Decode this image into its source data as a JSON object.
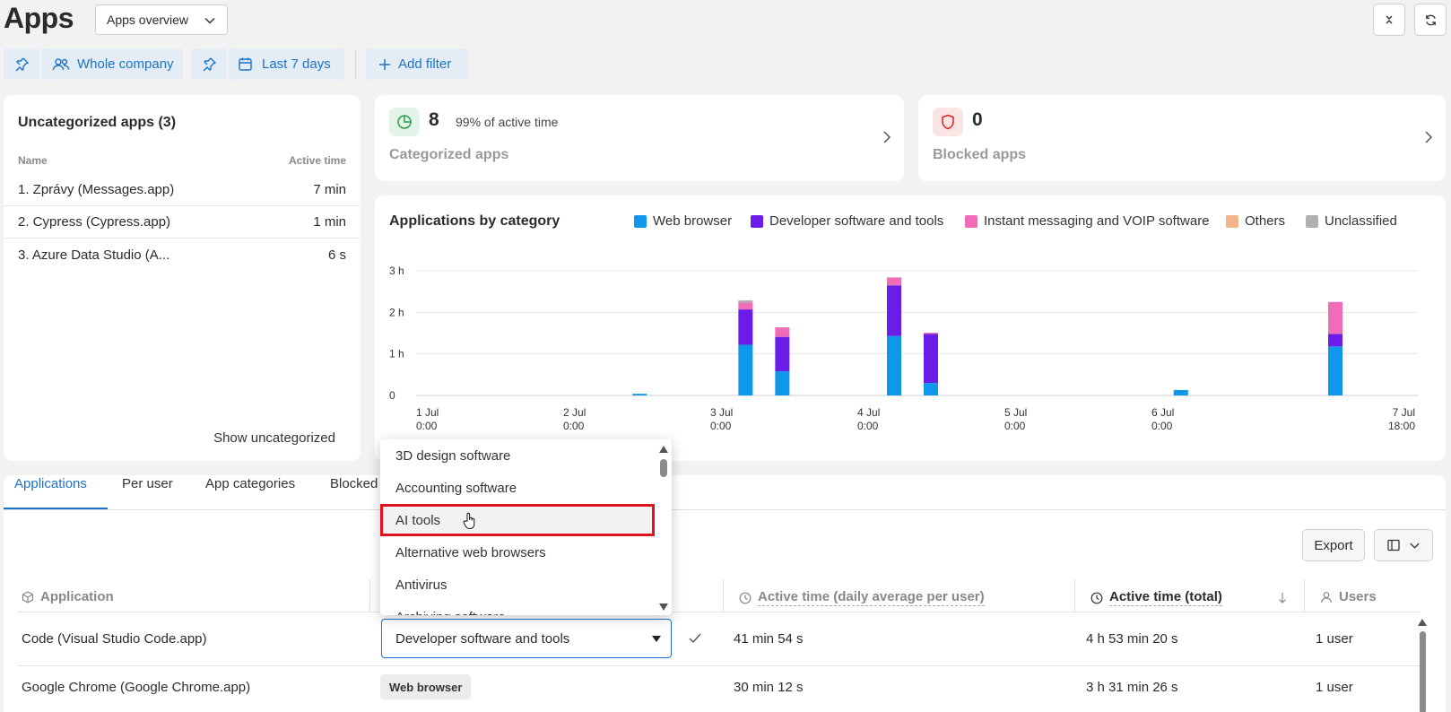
{
  "header": {
    "title": "Apps",
    "view_select": "Apps overview"
  },
  "filters": {
    "scope": "Whole company",
    "period": "Last 7 days",
    "add_filter": "Add filter"
  },
  "uncategorized": {
    "title": "Uncategorized apps (3)",
    "col_name": "Name",
    "col_time": "Active time",
    "rows": [
      {
        "name": "1. Zprávy (Messages.app)",
        "time": "7 min"
      },
      {
        "name": "2. Cypress (Cypress.app)",
        "time": "1 min"
      },
      {
        "name": "3. Azure Data Studio (A...",
        "time": "6 s"
      }
    ],
    "show_link": "Show uncategorized"
  },
  "categorized": {
    "count": "8",
    "sub": "99% of active time",
    "label": "Categorized apps"
  },
  "blocked": {
    "count": "0",
    "label": "Blocked apps"
  },
  "colors": {
    "web_browser": "#0f97ec",
    "developer": "#6a1de8",
    "messaging": "#f06cb8",
    "others": "#f4b48a",
    "unclassified": "#b0b0b0",
    "accent": "#1a73c9"
  },
  "chart_data": {
    "type": "bar",
    "title": "Applications by category",
    "stacked": true,
    "y_unit": "hours",
    "y_ticks": [
      "0",
      "1 h",
      "2 h",
      "3 h"
    ],
    "ylim": [
      0,
      3
    ],
    "x_ticks": [
      {
        "line1": "1 Jul",
        "line2": "0:00"
      },
      {
        "line1": "2 Jul",
        "line2": "0:00"
      },
      {
        "line1": "3 Jul",
        "line2": "0:00"
      },
      {
        "line1": "4 Jul",
        "line2": "0:00"
      },
      {
        "line1": "5 Jul",
        "line2": "0:00"
      },
      {
        "line1": "6 Jul",
        "line2": "0:00"
      },
      {
        "line1": "7 Jul",
        "line2": "18:00"
      }
    ],
    "legend": [
      {
        "name": "Web browser",
        "color_key": "web_browser"
      },
      {
        "name": "Developer software and tools",
        "color_key": "developer"
      },
      {
        "name": "Instant messaging and VOIP software",
        "color_key": "messaging"
      },
      {
        "name": "Others",
        "color_key": "others"
      },
      {
        "name": "Unclassified",
        "color_key": "unclassified"
      }
    ],
    "bars": [
      {
        "day_offset": 1.52,
        "web": 0.04,
        "dev": 0,
        "msg": 0,
        "other": 0,
        "uncl": 0
      },
      {
        "day_offset": 2.24,
        "web": 1.22,
        "dev": 0.85,
        "msg": 0.17,
        "other": 0,
        "uncl": 0.05
      },
      {
        "day_offset": 2.49,
        "web": 0.58,
        "dev": 0.83,
        "msg": 0.23,
        "other": 0,
        "uncl": 0
      },
      {
        "day_offset": 3.25,
        "web": 1.43,
        "dev": 1.22,
        "msg": 0.19,
        "other": 0,
        "uncl": 0
      },
      {
        "day_offset": 3.5,
        "web": 0.3,
        "dev": 1.18,
        "msg": 0.03,
        "other": 0,
        "uncl": 0
      },
      {
        "day_offset": 5.2,
        "web": 0.13,
        "dev": 0,
        "msg": 0,
        "other": 0,
        "uncl": 0
      },
      {
        "day_offset": 6.25,
        "web": 1.18,
        "dev": 0.3,
        "msg": 0.77,
        "other": 0,
        "uncl": 0
      }
    ]
  },
  "tabs": [
    "Applications",
    "Per user",
    "App categories",
    "Blocked"
  ],
  "toolbar": {
    "export": "Export"
  },
  "table": {
    "col_app": "Application",
    "col_daily": "Active time (daily average per user)",
    "col_total": "Active time (total)",
    "col_users": "Users",
    "rows": [
      {
        "app": "Code (Visual Studio Code.app)",
        "category": "Developer software and tools",
        "daily": "41 min 54 s",
        "total": "4 h 53 min 20 s",
        "users": "1 user"
      },
      {
        "app": "Google Chrome (Google Chrome.app)",
        "category": "Web browser",
        "daily": "30 min 12 s",
        "total": "3 h 31 min 26 s",
        "users": "1 user"
      }
    ]
  },
  "dropdown": {
    "items": [
      "3D design software",
      "Accounting software",
      "AI tools",
      "Alternative web browsers",
      "Antivirus",
      "Archiving software"
    ],
    "highlighted_index": 2
  }
}
